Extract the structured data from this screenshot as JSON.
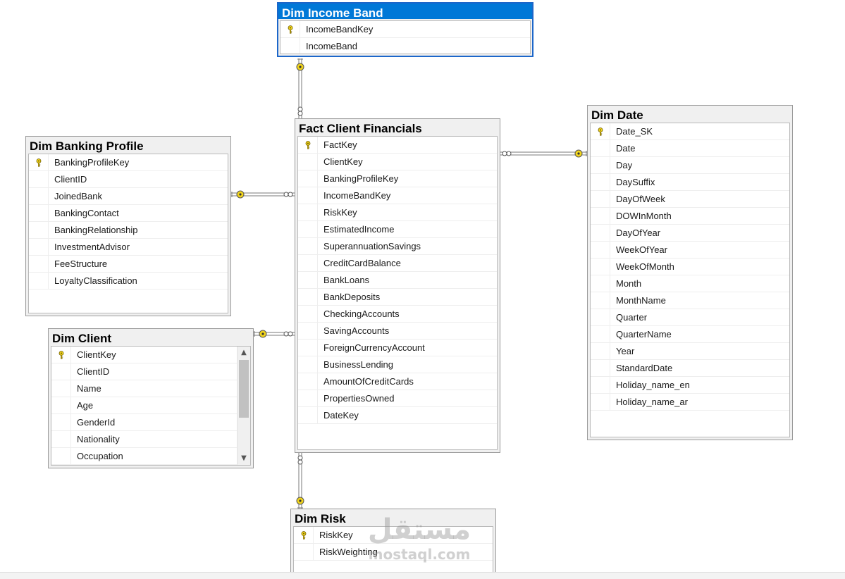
{
  "tables": {
    "income_band": {
      "title": "Dim Income Band",
      "columns": [
        {
          "name": "IncomeBandKey",
          "pk": true
        },
        {
          "name": "IncomeBand",
          "pk": false
        }
      ]
    },
    "fact": {
      "title": "Fact Client Financials",
      "columns": [
        {
          "name": "FactKey",
          "pk": true
        },
        {
          "name": "ClientKey",
          "pk": false
        },
        {
          "name": "BankingProfileKey",
          "pk": false
        },
        {
          "name": "IncomeBandKey",
          "pk": false
        },
        {
          "name": "RiskKey",
          "pk": false
        },
        {
          "name": "EstimatedIncome",
          "pk": false
        },
        {
          "name": "SuperannuationSavings",
          "pk": false
        },
        {
          "name": "CreditCardBalance",
          "pk": false
        },
        {
          "name": "BankLoans",
          "pk": false
        },
        {
          "name": "BankDeposits",
          "pk": false
        },
        {
          "name": "CheckingAccounts",
          "pk": false
        },
        {
          "name": "SavingAccounts",
          "pk": false
        },
        {
          "name": "ForeignCurrencyAccount",
          "pk": false
        },
        {
          "name": "BusinessLending",
          "pk": false
        },
        {
          "name": "AmountOfCreditCards",
          "pk": false
        },
        {
          "name": "PropertiesOwned",
          "pk": false
        },
        {
          "name": "DateKey",
          "pk": false
        }
      ]
    },
    "banking_profile": {
      "title": "Dim Banking Profile",
      "columns": [
        {
          "name": "BankingProfileKey",
          "pk": true
        },
        {
          "name": "ClientID",
          "pk": false
        },
        {
          "name": "JoinedBank",
          "pk": false
        },
        {
          "name": "BankingContact",
          "pk": false
        },
        {
          "name": "BankingRelationship",
          "pk": false
        },
        {
          "name": "InvestmentAdvisor",
          "pk": false
        },
        {
          "name": "FeeStructure",
          "pk": false
        },
        {
          "name": "LoyaltyClassification",
          "pk": false
        }
      ]
    },
    "client": {
      "title": "Dim Client",
      "columns": [
        {
          "name": "ClientKey",
          "pk": true
        },
        {
          "name": "ClientID",
          "pk": false
        },
        {
          "name": "Name",
          "pk": false
        },
        {
          "name": "Age",
          "pk": false
        },
        {
          "name": "GenderId",
          "pk": false
        },
        {
          "name": "Nationality",
          "pk": false
        },
        {
          "name": "Occupation",
          "pk": false
        }
      ]
    },
    "date": {
      "title": "Dim Date",
      "columns": [
        {
          "name": "Date_SK",
          "pk": true
        },
        {
          "name": "Date",
          "pk": false
        },
        {
          "name": "Day",
          "pk": false
        },
        {
          "name": "DaySuffix",
          "pk": false
        },
        {
          "name": "DayOfWeek",
          "pk": false
        },
        {
          "name": "DOWInMonth",
          "pk": false
        },
        {
          "name": "DayOfYear",
          "pk": false
        },
        {
          "name": "WeekOfYear",
          "pk": false
        },
        {
          "name": "WeekOfMonth",
          "pk": false
        },
        {
          "name": "Month",
          "pk": false
        },
        {
          "name": "MonthName",
          "pk": false
        },
        {
          "name": "Quarter",
          "pk": false
        },
        {
          "name": "QuarterName",
          "pk": false
        },
        {
          "name": "Year",
          "pk": false
        },
        {
          "name": "StandardDate",
          "pk": false
        },
        {
          "name": "Holiday_name_en",
          "pk": false
        },
        {
          "name": "Holiday_name_ar",
          "pk": false
        }
      ]
    },
    "risk": {
      "title": "Dim Risk",
      "columns": [
        {
          "name": "RiskKey",
          "pk": true
        },
        {
          "name": "RiskWeighting",
          "pk": false
        }
      ]
    }
  },
  "relationships": [
    {
      "one": "income_band",
      "many": "fact"
    },
    {
      "one": "banking_profile",
      "many": "fact"
    },
    {
      "one": "client",
      "many": "fact"
    },
    {
      "one": "date",
      "many": "fact"
    },
    {
      "one": "risk",
      "many": "fact"
    }
  ],
  "selected_table": "income_band",
  "colors": {
    "selection": "#0078d7",
    "key_icon": "#f2d51c",
    "line": "#7a7a7a"
  },
  "watermark": {
    "arabic": "مستقل",
    "latin": "mostaql.com"
  }
}
